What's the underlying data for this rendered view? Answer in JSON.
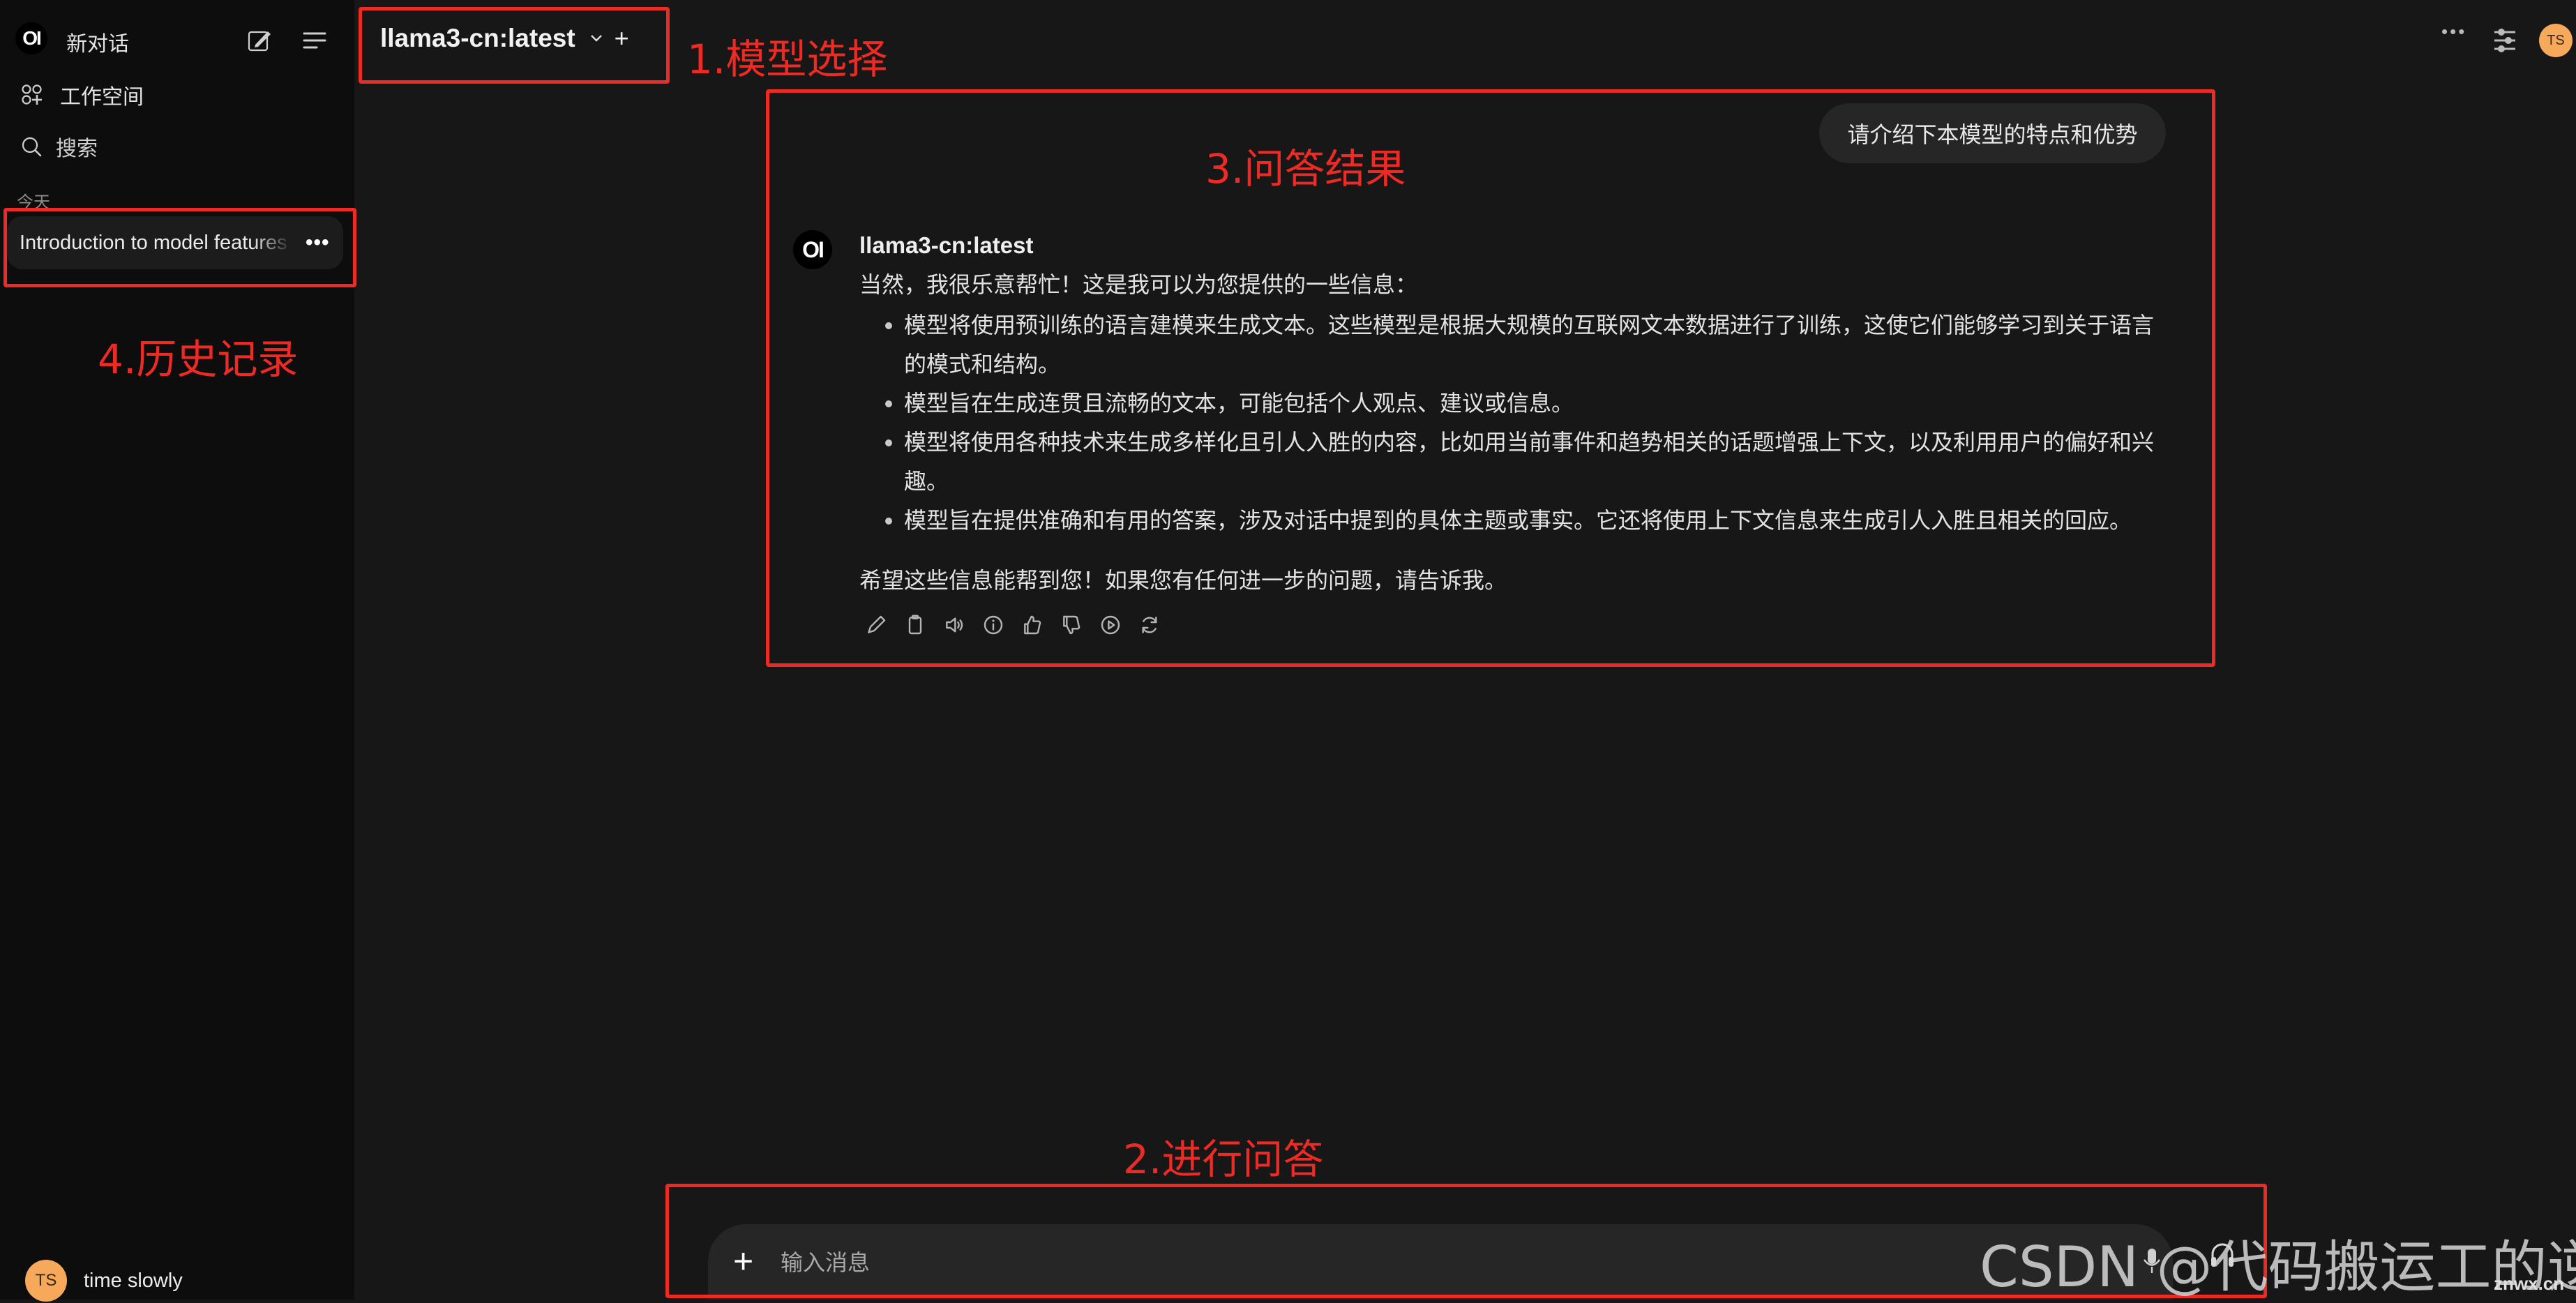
{
  "sidebar": {
    "brand_logo": "OI",
    "new_chat_label": "新对话",
    "workspace_label": "工作空间",
    "search_label": "搜索",
    "section_today": "今天",
    "history": [
      {
        "title": "Introduction to model features",
        "more": "•••"
      }
    ],
    "user": {
      "initials": "TS",
      "name": "time slowly"
    }
  },
  "header": {
    "model_name": "llama3-cn:latest",
    "add_model": "+",
    "more": "•••",
    "avatar_initials": "TS"
  },
  "chat": {
    "user_message": "请介绍下本模型的特点和优势",
    "assistant": {
      "logo": "OI",
      "model": "llama3-cn:latest",
      "intro": "当然，我很乐意帮忙！这是我可以为您提供的一些信息：",
      "bullets": [
        "模型将使用预训练的语言建模来生成文本。这些模型是根据大规模的互联网文本数据进行了训练，这使它们能够学习到关于语言的模式和结构。",
        "模型旨在生成连贯且流畅的文本，可能包括个人观点、建议或信息。",
        "模型将使用各种技术来生成多样化且引人入胜的内容，比如用当前事件和趋势相关的话题增强上下文，以及利用用户的偏好和兴趣。",
        "模型旨在提供准确和有用的答案，涉及对话中提到的具体主题或事实。它还将使用上下文信息来生成引人入胜且相关的回应。"
      ],
      "closing": "希望这些信息能帮到您！如果您有任何进一步的问题，请告诉我。"
    }
  },
  "input": {
    "plus": "+",
    "placeholder": "输入消息"
  },
  "annotations": {
    "a1": "1.模型选择",
    "a2": "2.进行问答",
    "a3": "3.问答结果",
    "a4": "4.历史记录",
    "color": "#ee2a24"
  },
  "watermark": {
    "main": "CSDN @代码搬运工的逆袭",
    "site": "znwx.cn"
  },
  "colors": {
    "sidebar_bg": "#0d0d0d",
    "main_bg": "#171717",
    "bubble_bg": "#262626",
    "avatar": "#f6a95a"
  }
}
